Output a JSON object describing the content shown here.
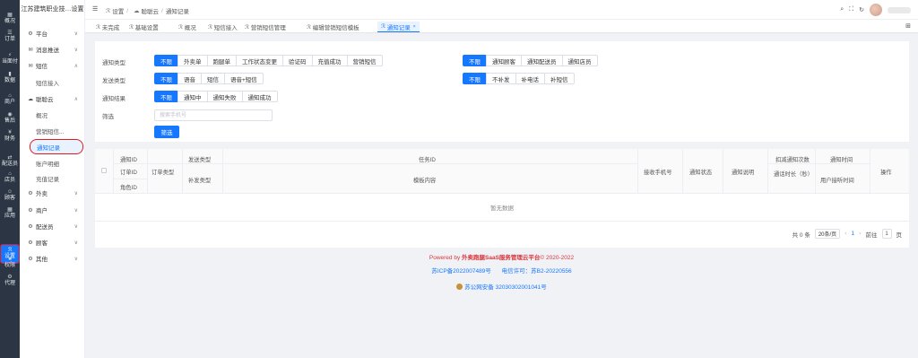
{
  "rail": {
    "items": [
      {
        "icon": "▦",
        "label": "概况"
      },
      {
        "icon": "☰",
        "label": "订单"
      },
      {
        "icon": "⚡",
        "label": "当面付"
      },
      {
        "icon": "▮",
        "label": "数据"
      },
      {
        "icon": "⌂",
        "label": "商户"
      },
      {
        "icon": "◉",
        "label": "售后"
      },
      {
        "icon": "¥",
        "label": "财务"
      },
      {
        "icon": "⇄",
        "label": "配送员"
      },
      {
        "icon": "⌂",
        "label": "店员"
      },
      {
        "icon": "☺",
        "label": "顾客"
      },
      {
        "icon": "▦",
        "label": "应用"
      },
      {
        "icon": "ℛ",
        "label": "设置"
      },
      {
        "icon": "■",
        "label": "权限"
      },
      {
        "icon": "⚙",
        "label": "代理"
      }
    ]
  },
  "menu": {
    "company": "江苏建筑职业技…设置",
    "items": [
      {
        "type": "group",
        "icon": "⚙",
        "label": "平台",
        "arrow": "∨"
      },
      {
        "type": "group",
        "icon": "✉",
        "label": "消息推送",
        "arrow": "∨"
      },
      {
        "type": "group",
        "icon": "✉",
        "label": "短信",
        "arrow": "∧"
      },
      {
        "type": "sub",
        "label": "短信接入"
      },
      {
        "type": "group",
        "icon": "☁",
        "label": "聪聪云",
        "arrow": "∧"
      },
      {
        "type": "sub",
        "label": "概况"
      },
      {
        "type": "sub",
        "label": "营销短信..."
      },
      {
        "type": "sub",
        "label": "通知记录",
        "active": true
      },
      {
        "type": "sub",
        "label": "账户明细"
      },
      {
        "type": "sub",
        "label": "充值记录"
      },
      {
        "type": "group",
        "icon": "⚙",
        "label": "外卖",
        "arrow": "∨"
      },
      {
        "type": "group",
        "icon": "⚙",
        "label": "商户",
        "arrow": "∨"
      },
      {
        "type": "group",
        "icon": "⚙",
        "label": "配送员",
        "arrow": "∨"
      },
      {
        "type": "group",
        "icon": "⚙",
        "label": "顾客",
        "arrow": "∨"
      },
      {
        "type": "group",
        "icon": "⚙",
        "label": "其他",
        "arrow": "∨"
      }
    ]
  },
  "topbar": {
    "fold_icon": "☰",
    "breadcrumb": [
      {
        "icon": "ℛ",
        "label": "设置"
      },
      {
        "icon": "☁",
        "label": "聪聪云"
      },
      {
        "icon": "",
        "label": "通知记录"
      }
    ],
    "separator": "/",
    "icons": [
      "⌕",
      "⛶",
      "↻"
    ]
  },
  "tabs": [
    {
      "label": "未完成"
    },
    {
      "label": "基础设置"
    },
    {
      "label": "概况"
    },
    {
      "label": "短信接入"
    },
    {
      "label": "营销短信管理"
    },
    {
      "label": "编辑营销短信模板"
    },
    {
      "label": "通知记录",
      "active": true,
      "close": "×"
    }
  ],
  "grid_icon": "⊞",
  "filters": {
    "notify_type": {
      "label": "通知类型",
      "options": [
        "不限",
        "外卖单",
        "跑腿单",
        "工作状态变更",
        "验证码",
        "充值成功",
        "营销短信"
      ],
      "selected": 0
    },
    "notify_target": {
      "options": [
        "不限",
        "通知顾客",
        "通知配送员",
        "通知店员"
      ],
      "selected": 0
    },
    "send_type": {
      "label": "发送类型",
      "options": [
        "不限",
        "语音",
        "短信",
        "语音+短信"
      ],
      "selected": 0
    },
    "resend": {
      "options": [
        "不限",
        "不补发",
        "补电话",
        "补短信"
      ],
      "selected": 0
    },
    "result": {
      "label": "通知结果",
      "options": [
        "不限",
        "通知中",
        "通知失败",
        "通知成功"
      ],
      "selected": 0
    },
    "screen": {
      "label": "筛选",
      "placeholder": "搜索手机号"
    },
    "submit": "筛选"
  },
  "table": {
    "headers": {
      "c1": [
        "通知ID",
        "订单ID",
        "角色ID"
      ],
      "order_type": "订单类型",
      "send_type": "发送类型",
      "resend_type": "补发类型",
      "task_id": "任务ID",
      "template": "模板内容",
      "phone": "接收手机号",
      "status": "通知状态",
      "desc": "通知说明",
      "deduct": "扣减通知次数",
      "duration": "通话时长（秒）",
      "notify_time": "通知时间",
      "answer_time": "用户接听时间",
      "action": "操作"
    },
    "empty": "暂无数据"
  },
  "pager": {
    "total": "共 0 条",
    "page_size": "20条/页",
    "prev": "‹",
    "current": "1",
    "next": "›",
    "goto": "前往",
    "page_input": "1",
    "page_unit": "页"
  },
  "footer": {
    "powered_prefix": "Powered by ",
    "powered_brand": "外卖跑腿SaaS服务管理云平台",
    "powered_suffix": "© 2020-2022",
    "icp": "苏ICP备2022007489号",
    "license": "电信许可：苏B2-20220556",
    "police": "苏公网安备 32030302001041号"
  }
}
